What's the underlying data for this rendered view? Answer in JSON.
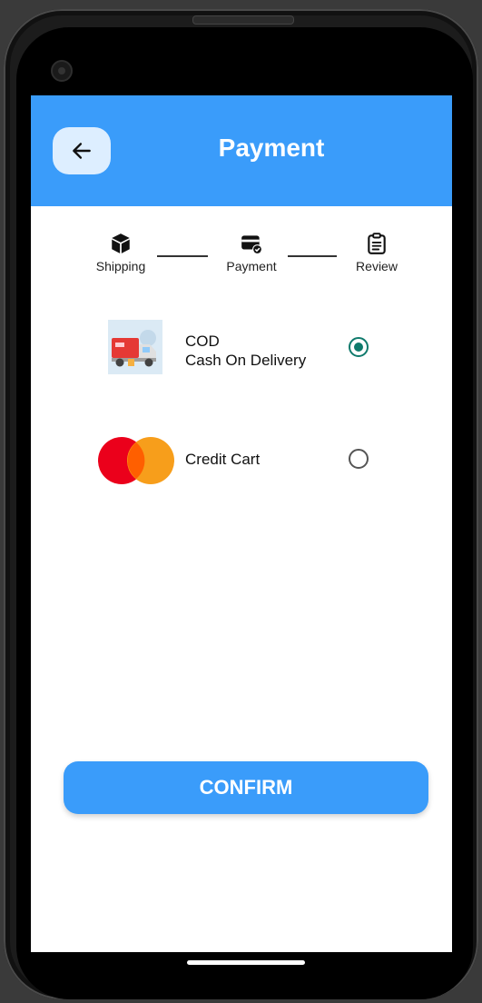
{
  "header": {
    "title": "Payment",
    "back_icon": "arrow-left-icon"
  },
  "steps": [
    {
      "label": "Shipping",
      "icon": "box-icon"
    },
    {
      "label": "Payment",
      "icon": "credit-card-check-icon"
    },
    {
      "label": "Review",
      "icon": "clipboard-icon"
    }
  ],
  "payment_options": [
    {
      "title": "COD",
      "subtitle": "Cash On Delivery",
      "selected": true,
      "logo": "delivery-truck-image"
    },
    {
      "title": "Credit Cart",
      "selected": false,
      "logo": "mastercard-logo"
    }
  ],
  "confirm_label": "CONFIRM",
  "colors": {
    "primary": "#3a9cfa",
    "radio_selected": "#0f7a6c",
    "mastercard_red": "#eb001b",
    "mastercard_orange": "#f79e1b"
  }
}
